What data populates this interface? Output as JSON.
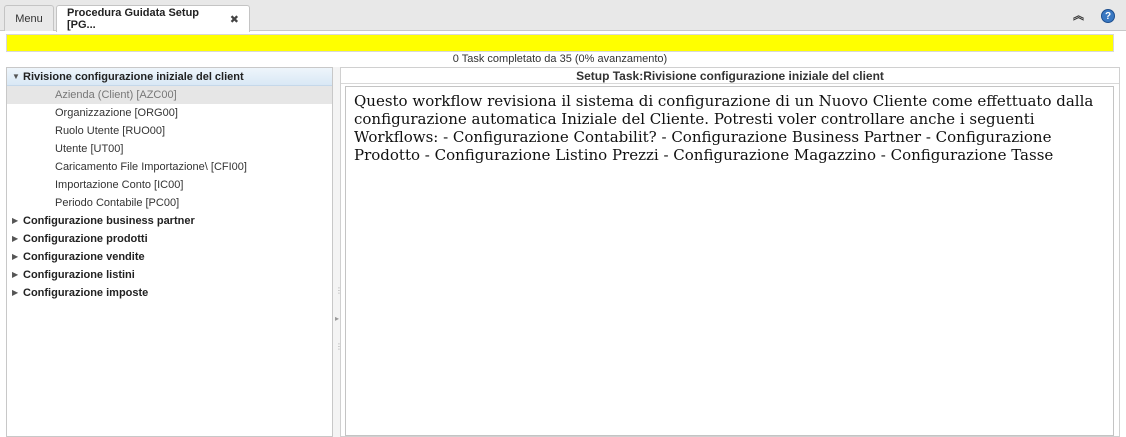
{
  "tabs": {
    "menu_label": "Menu",
    "active_label": "Procedura Guidata Setup [PG...",
    "close_glyph": "✖"
  },
  "toolbar": {
    "collapse_glyph": "︽",
    "help_glyph": "?"
  },
  "progress": {
    "completed": 0,
    "total": 35,
    "percent": 0,
    "text": "0 Task completato da 35 (0% avanzamento)",
    "fill_color": "#ffff00"
  },
  "tree": {
    "groups": [
      {
        "label": "Rivisione configurazione iniziale del client",
        "expanded": true,
        "children": [
          {
            "label": "Azienda (Client) [AZC00]",
            "selected": true
          },
          {
            "label": "Organizzazione [ORG00]"
          },
          {
            "label": "Ruolo Utente [RUO00]"
          },
          {
            "label": "Utente [UT00]"
          },
          {
            "label": "Caricamento File Importazione\\ [CFI00]"
          },
          {
            "label": "Importazione Conto [IC00]"
          },
          {
            "label": "Periodo Contabile [PC00]"
          }
        ]
      },
      {
        "label": "Configurazione business partner",
        "expanded": false
      },
      {
        "label": "Configurazione prodotti",
        "expanded": false
      },
      {
        "label": "Configurazione vendite",
        "expanded": false
      },
      {
        "label": "Configurazione listini",
        "expanded": false
      },
      {
        "label": "Configurazione imposte",
        "expanded": false
      }
    ]
  },
  "detail": {
    "title": "Setup Task:Rivisione configurazione iniziale del client",
    "description": "Questo workflow revisiona il sistema di configurazione di un Nuovo Cliente come effettuato dalla configurazione automatica Iniziale del Cliente. Potresti voler controllare anche i seguenti Workflows: - Configurazione Contabilit? - Configurazione Business Partner - Configurazione Prodotto - Configurazione Listino Prezzi - Configurazione Magazzino - Configurazione Tasse"
  }
}
